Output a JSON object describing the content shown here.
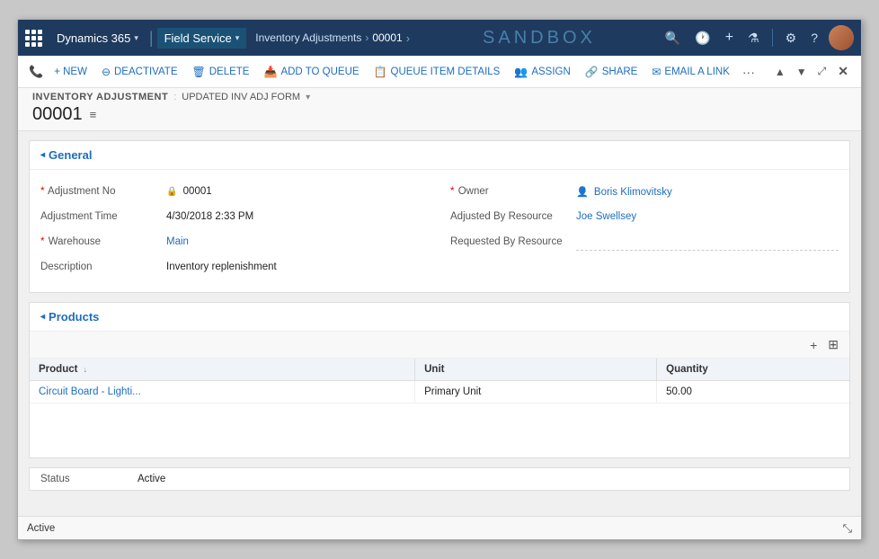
{
  "app": {
    "brand": "Dynamics 365",
    "module": "Field Service",
    "sandbox_label": "SANDBOX",
    "breadcrumb": {
      "parent": "Inventory Adjustments",
      "current": "00001"
    }
  },
  "nav_icons": {
    "search": "🔍",
    "history": "🕐",
    "add": "+",
    "filter": "⚗",
    "settings": "⚙",
    "help": "?",
    "apps_grid": "⊞"
  },
  "command_bar": {
    "new": "+ NEW",
    "deactivate": "DEACTIVATE",
    "delete": "DELETE",
    "add_to_queue": "ADD TO QUEUE",
    "queue_item_details": "QUEUE ITEM DETAILS",
    "assign": "ASSIGN",
    "share": "SHARE",
    "email_a_link": "EMAIL A LINK",
    "more": "···"
  },
  "record": {
    "entity_label": "INVENTORY ADJUSTMENT",
    "separator": ":",
    "form_title": "UPDATED INV ADJ FORM",
    "id": "00001"
  },
  "general_section": {
    "title": "General",
    "fields_left": [
      {
        "label": "Adjustment No",
        "value": "00001",
        "required": true,
        "locked": true
      },
      {
        "label": "Adjustment Time",
        "value": "4/30/2018  2:33 PM",
        "required": false
      },
      {
        "label": "Warehouse",
        "value": "Main",
        "required": true,
        "link": true
      },
      {
        "label": "Description",
        "value": "Inventory replenishment",
        "required": false
      }
    ],
    "fields_right": [
      {
        "label": "Owner",
        "value": "Boris Klimovitsky",
        "required": true,
        "person": true,
        "link": true
      },
      {
        "label": "Adjusted By Resource",
        "value": "Joe Swellsey",
        "required": false,
        "link": true
      },
      {
        "label": "Requested By Resource",
        "value": "",
        "required": false,
        "dotted": true
      }
    ]
  },
  "products_section": {
    "title": "Products",
    "columns": [
      {
        "label": "Product",
        "sort": true
      },
      {
        "label": "Unit",
        "sort": false
      },
      {
        "label": "Quantity",
        "sort": false
      }
    ],
    "rows": [
      {
        "product": "Circuit Board - Lighti...",
        "unit": "Primary Unit",
        "quantity": "50.00"
      }
    ]
  },
  "status": {
    "label": "Status",
    "value": "Active"
  },
  "bottom_bar": {
    "status": "Active"
  }
}
